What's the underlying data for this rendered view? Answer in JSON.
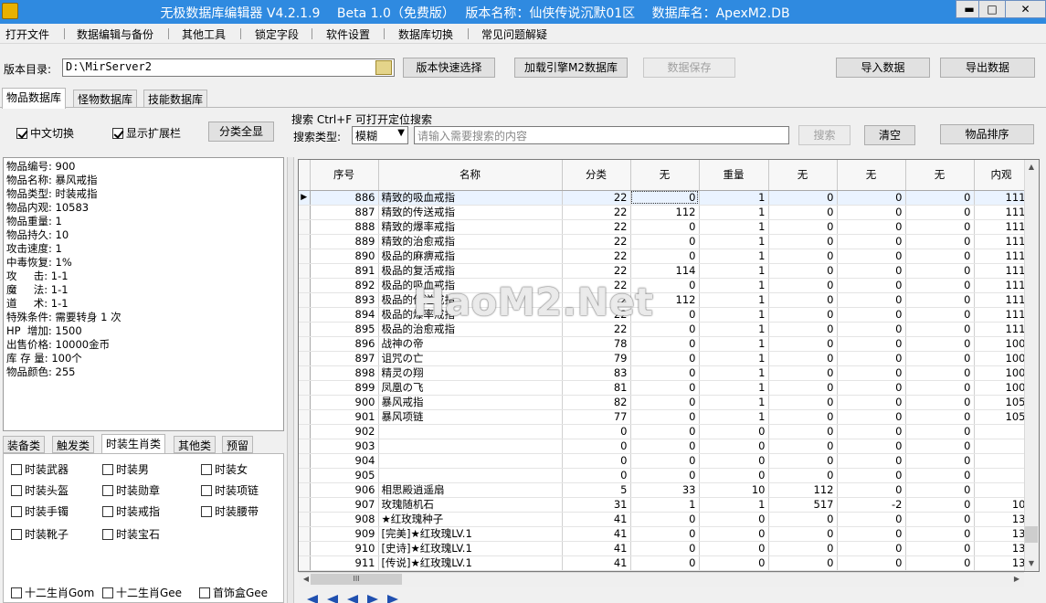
{
  "title": "无极数据库编辑器 V4.2.1.9　 Beta 1.0（免费版）　 版本名称：仙侠传说沉默01区　 数据库名：ApexM2.DB",
  "window": {
    "minimize": "▬",
    "maximize": "□",
    "close": "✕"
  },
  "menu": [
    "打开文件",
    "数据编辑与备份",
    "其他工具",
    "锁定字段",
    "软件设置",
    "数据库切换",
    "常见问题解疑"
  ],
  "toolbar": {
    "dir_label": "版本目录:",
    "dir_value": "D:\\MirServer2",
    "quick_select": "版本快速选择",
    "load_engine": "加载引擎M2数据库",
    "save": "数据保存",
    "import": "导入数据",
    "export": "导出数据"
  },
  "tabs": [
    "物品数据库",
    "怪物数据库",
    "技能数据库"
  ],
  "options": {
    "chinese": "中文切换",
    "show_ext": "显示扩展栏",
    "show_all": "分类全显"
  },
  "search": {
    "title": "搜索  Ctrl+F 可打开定位搜索",
    "type_label": "搜索类型:",
    "type_value": "模糊",
    "placeholder": "请输入需要搜索的内容",
    "search_btn": "搜索",
    "clear_btn": "清空",
    "sort_btn": "物品排序"
  },
  "item_info": [
    "物品编号: 900",
    "物品名称: 暴风戒指",
    "物品类型: 时装戒指",
    "物品内观: 10583",
    "物品重量: 1",
    "物品持久: 10",
    "攻击速度: 1",
    "中毒恢复: 1%",
    "攻     击: 1-1",
    "魔     法: 1-1",
    "道     术: 1-1",
    "特殊条件: 需要转身 1 次",
    "HP  增加: 1500",
    "出售价格: 10000金币",
    "库 存 量: 100个",
    "物品颜色: 255"
  ],
  "category_tabs": [
    "装备类",
    "触发类",
    "时装生肖类",
    "其他类",
    "预留"
  ],
  "categories": [
    "时装武器",
    "时装男",
    "时装女",
    "时装头盔",
    "时装勋章",
    "时装项链",
    "时装手镯",
    "时装戒指",
    "时装腰带",
    "时装靴子",
    "时装宝石"
  ],
  "zodiac": [
    "十二生肖Gom",
    "十二生肖Gee",
    "首饰盒Gee"
  ],
  "columns": [
    "序号",
    "名称",
    "分类",
    "无",
    "重量",
    "无",
    "无",
    "无",
    "内观"
  ],
  "rows": [
    [
      "886",
      "精致的吸血戒指",
      "22",
      "0",
      "1",
      "0",
      "0",
      "0",
      "111"
    ],
    [
      "887",
      "精致的传送戒指",
      "22",
      "112",
      "1",
      "0",
      "0",
      "0",
      "111"
    ],
    [
      "888",
      "精致的爆率戒指",
      "22",
      "0",
      "1",
      "0",
      "0",
      "0",
      "111"
    ],
    [
      "889",
      "精致的治愈戒指",
      "22",
      "0",
      "1",
      "0",
      "0",
      "0",
      "111"
    ],
    [
      "890",
      "极品的麻痹戒指",
      "22",
      "0",
      "1",
      "0",
      "0",
      "0",
      "111"
    ],
    [
      "891",
      "极品的复活戒指",
      "22",
      "114",
      "1",
      "0",
      "0",
      "0",
      "111"
    ],
    [
      "892",
      "极品的吸血戒指",
      "22",
      "0",
      "1",
      "0",
      "0",
      "0",
      "111"
    ],
    [
      "893",
      "极品的传送戒指",
      "22",
      "112",
      "1",
      "0",
      "0",
      "0",
      "111"
    ],
    [
      "894",
      "极品的爆率戒指",
      "22",
      "0",
      "1",
      "0",
      "0",
      "0",
      "111"
    ],
    [
      "895",
      "极品的治愈戒指",
      "22",
      "0",
      "1",
      "0",
      "0",
      "0",
      "111"
    ],
    [
      "896",
      "战神の帝",
      "78",
      "0",
      "1",
      "0",
      "0",
      "0",
      "100"
    ],
    [
      "897",
      "诅咒の亡",
      "79",
      "0",
      "1",
      "0",
      "0",
      "0",
      "100"
    ],
    [
      "898",
      "精灵の翔",
      "83",
      "0",
      "1",
      "0",
      "0",
      "0",
      "100"
    ],
    [
      "899",
      "凤凰の飞",
      "81",
      "0",
      "1",
      "0",
      "0",
      "0",
      "100"
    ],
    [
      "900",
      "暴风戒指",
      "82",
      "0",
      "1",
      "0",
      "0",
      "0",
      "105"
    ],
    [
      "901",
      "暴风项链",
      "77",
      "0",
      "1",
      "0",
      "0",
      "0",
      "105"
    ],
    [
      "902",
      "",
      "0",
      "0",
      "0",
      "0",
      "0",
      "0",
      ""
    ],
    [
      "903",
      "",
      "0",
      "0",
      "0",
      "0",
      "0",
      "0",
      ""
    ],
    [
      "904",
      "",
      "0",
      "0",
      "0",
      "0",
      "0",
      "0",
      ""
    ],
    [
      "905",
      "",
      "0",
      "0",
      "0",
      "0",
      "0",
      "0",
      ""
    ],
    [
      "906",
      "相思殿逍遥扇",
      "5",
      "33",
      "10",
      "112",
      "0",
      "0",
      ""
    ],
    [
      "907",
      "玫瑰随机石",
      "31",
      "1",
      "1",
      "517",
      "-2",
      "0",
      "10"
    ],
    [
      "908",
      "★红玫瑰种子",
      "41",
      "0",
      "0",
      "0",
      "0",
      "0",
      "13"
    ],
    [
      "909",
      "[完美]★红玫瑰LV.1",
      "41",
      "0",
      "0",
      "0",
      "0",
      "0",
      "13"
    ],
    [
      "910",
      "[史诗]★红玫瑰LV.1",
      "41",
      "0",
      "0",
      "0",
      "0",
      "0",
      "13"
    ],
    [
      "911",
      "[传说]★红玫瑰LV.1",
      "41",
      "0",
      "0",
      "0",
      "0",
      "0",
      "13"
    ]
  ],
  "watermark": "HaoM2.Net",
  "hscroll_grip": "III"
}
